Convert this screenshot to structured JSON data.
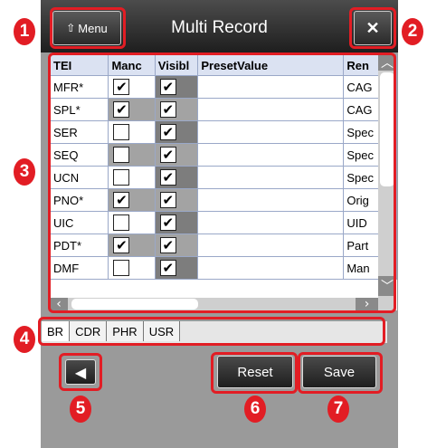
{
  "window": {
    "title": "Multi Record",
    "menu_label": "Menu",
    "close_label": "✕"
  },
  "grid": {
    "columns": [
      "TEI",
      "Manc",
      "Visibl",
      "PresetValue",
      "Ren"
    ],
    "rows": [
      {
        "tei": "MFR*",
        "mand": true,
        "vis": true,
        "preset": "",
        "ren": "CAG"
      },
      {
        "tei": "SPL*",
        "mand": true,
        "vis": true,
        "preset": "",
        "ren": "CAG"
      },
      {
        "tei": "SER",
        "mand": false,
        "vis": true,
        "preset": "",
        "ren": "Spec"
      },
      {
        "tei": "SEQ",
        "mand": false,
        "vis": true,
        "preset": "",
        "ren": "Spec"
      },
      {
        "tei": "UCN",
        "mand": false,
        "vis": true,
        "preset": "",
        "ren": "Spec"
      },
      {
        "tei": "PNO*",
        "mand": true,
        "vis": true,
        "preset": "",
        "ren": "Orig"
      },
      {
        "tei": "UIC",
        "mand": false,
        "vis": true,
        "preset": "",
        "ren": "UID"
      },
      {
        "tei": "PDT*",
        "mand": true,
        "vis": true,
        "preset": "",
        "ren": "Part"
      },
      {
        "tei": "DMF",
        "mand": false,
        "vis": true,
        "preset": "",
        "ren": "Man"
      }
    ]
  },
  "tabs": [
    {
      "label": "BR",
      "active": true
    },
    {
      "label": "CDR",
      "active": false
    },
    {
      "label": "PHR",
      "active": false
    },
    {
      "label": "USR",
      "active": false
    }
  ],
  "buttons": {
    "back_label": "🡐",
    "reset_label": "Reset",
    "save_label": "Save"
  },
  "callouts": [
    "1",
    "2",
    "3",
    "4",
    "5",
    "6",
    "7"
  ],
  "colors": {
    "callout": "#e21d24",
    "titlebar": "#2a2a2a"
  }
}
